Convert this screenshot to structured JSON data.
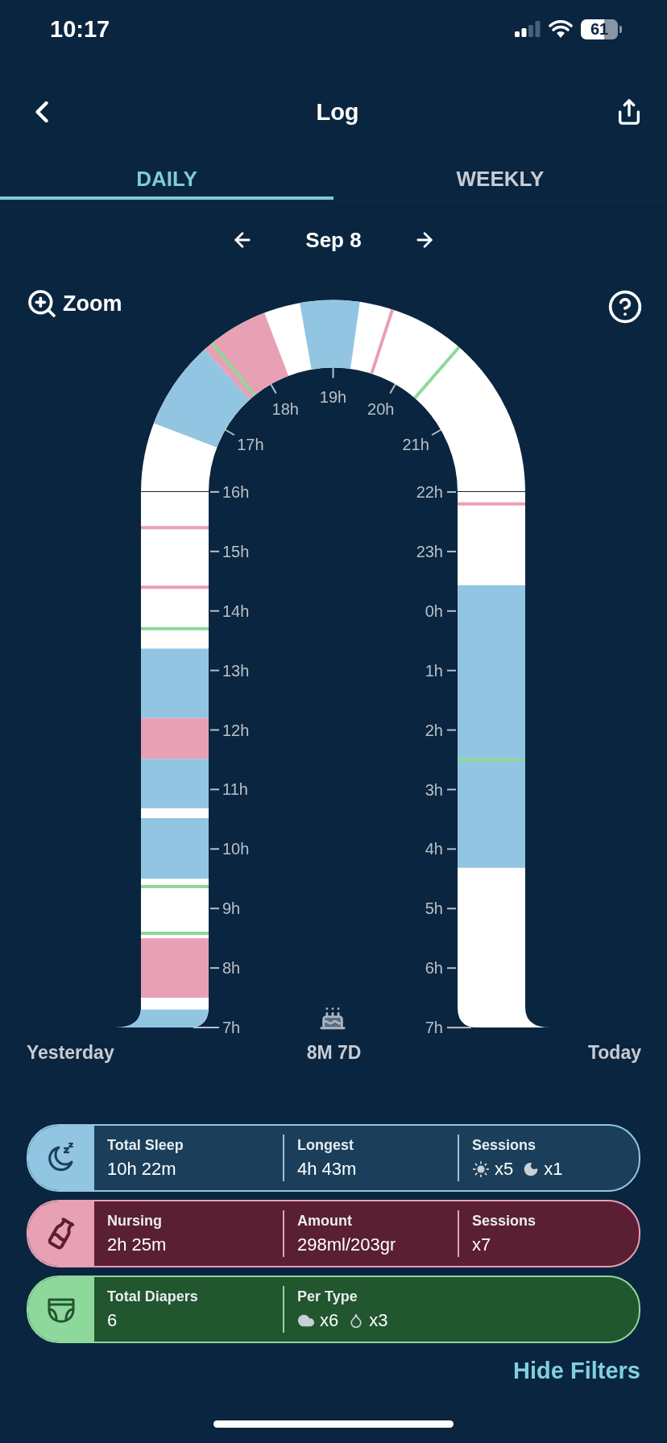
{
  "status_bar": {
    "time": "10:17",
    "battery": "61"
  },
  "header": {
    "title": "Log"
  },
  "tabs": [
    {
      "label": "DAILY",
      "selected": true
    },
    {
      "label": "WEEKLY",
      "selected": false
    }
  ],
  "date_nav": {
    "date": "Sep 8"
  },
  "zoom": {
    "label": "Zoom"
  },
  "timeline": {
    "arch_hour_labels": [
      "17h",
      "18h",
      "19h",
      "20h",
      "21h"
    ],
    "left_hour_labels": [
      "16h",
      "15h",
      "14h",
      "13h",
      "12h",
      "11h",
      "10h",
      "9h",
      "8h",
      "7h"
    ],
    "right_hour_labels": [
      "22h",
      "23h",
      "0h",
      "1h",
      "2h",
      "3h",
      "4h",
      "5h",
      "6h",
      "7h"
    ],
    "start_label": "Yesterday",
    "age": "8M 7D",
    "end_label": "Today"
  },
  "summary": [
    {
      "kind": "sleep",
      "stats": [
        {
          "kind": "text",
          "label": "Total Sleep",
          "value": "10h 22m"
        },
        {
          "kind": "text",
          "label": "Longest",
          "value": "4h 43m"
        },
        {
          "kind": "counts",
          "label": "Sessions",
          "counts": [
            "x5",
            "x1"
          ]
        }
      ]
    },
    {
      "kind": "nursing",
      "stats": [
        {
          "kind": "text",
          "label": "Nursing",
          "value": "2h 25m"
        },
        {
          "kind": "text",
          "label": "Amount",
          "value": "298ml/203gr"
        },
        {
          "kind": "text",
          "label": "Sessions",
          "value": "x7"
        }
      ]
    },
    {
      "kind": "diaper",
      "stats": [
        {
          "kind": "text",
          "label": "Total Diapers",
          "value": "6"
        },
        {
          "kind": "counts",
          "label": "Per Type",
          "counts": [
            "x6",
            "x3"
          ]
        }
      ]
    }
  ],
  "hide_filters": "Hide Filters"
}
